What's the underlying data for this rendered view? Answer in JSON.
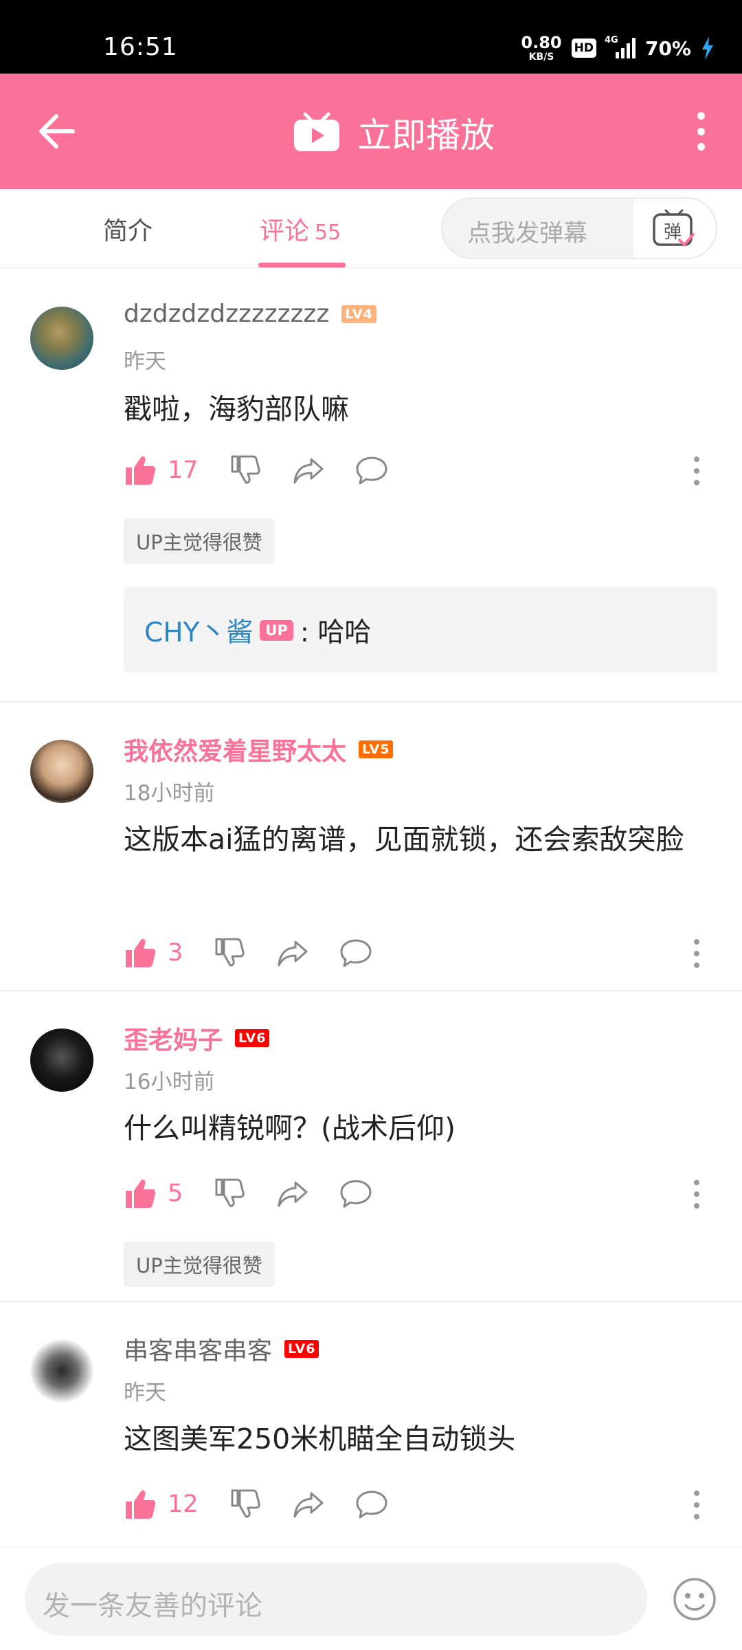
{
  "status_bar": {
    "time": "16:51",
    "net_speed_value": "0.80",
    "net_speed_unit": "KB/S",
    "hd_badge": "HD",
    "network": "4G",
    "battery": "70%"
  },
  "header": {
    "play_label": "立即播放",
    "icons": {
      "back": "arrow-left-icon",
      "tv": "tv-play-icon",
      "more": "more-vertical-icon"
    }
  },
  "tabs": {
    "intro": "简介",
    "comments": "评论",
    "comments_count": "55",
    "danmaku_placeholder": "点我发弹幕",
    "danmaku_icon_char": "弹"
  },
  "comments": [
    {
      "username": "dzdzdzdzzzzzzzz",
      "level": "LV4",
      "time": "昨天",
      "text": "戳啦，海豹部队嘛",
      "likes": "17",
      "up_tag": "UP主觉得很赞",
      "reply": {
        "user": "CHY丶酱",
        "badge": "UP",
        "text": ": 哈哈"
      }
    },
    {
      "username": "我依然爱着星野太太",
      "level": "LV5",
      "time": "18小时前",
      "text": "这版本ai猛的离谱，见面就锁，还会索敌突脸",
      "likes": "3"
    },
    {
      "username": "歪老妈子",
      "level": "LV6",
      "time": "16小时前",
      "text": "什么叫精锐啊？(战术后仰)",
      "likes": "5",
      "up_tag": "UP主觉得很赞"
    },
    {
      "username": "串客串客串客",
      "level": "LV6",
      "time": "昨天",
      "text": "这图美军250米机瞄全自动锁头",
      "likes": "12"
    }
  ],
  "bottom_bar": {
    "placeholder": "发一条友善的评论",
    "emoji_icon": "emoji-face-icon"
  },
  "colors": {
    "brand_pink": "#fb7299",
    "reply_blue": "#2b85c4",
    "lv4": "#ffb37c",
    "lv5": "#ff6c00",
    "lv6": "#ff0000"
  }
}
